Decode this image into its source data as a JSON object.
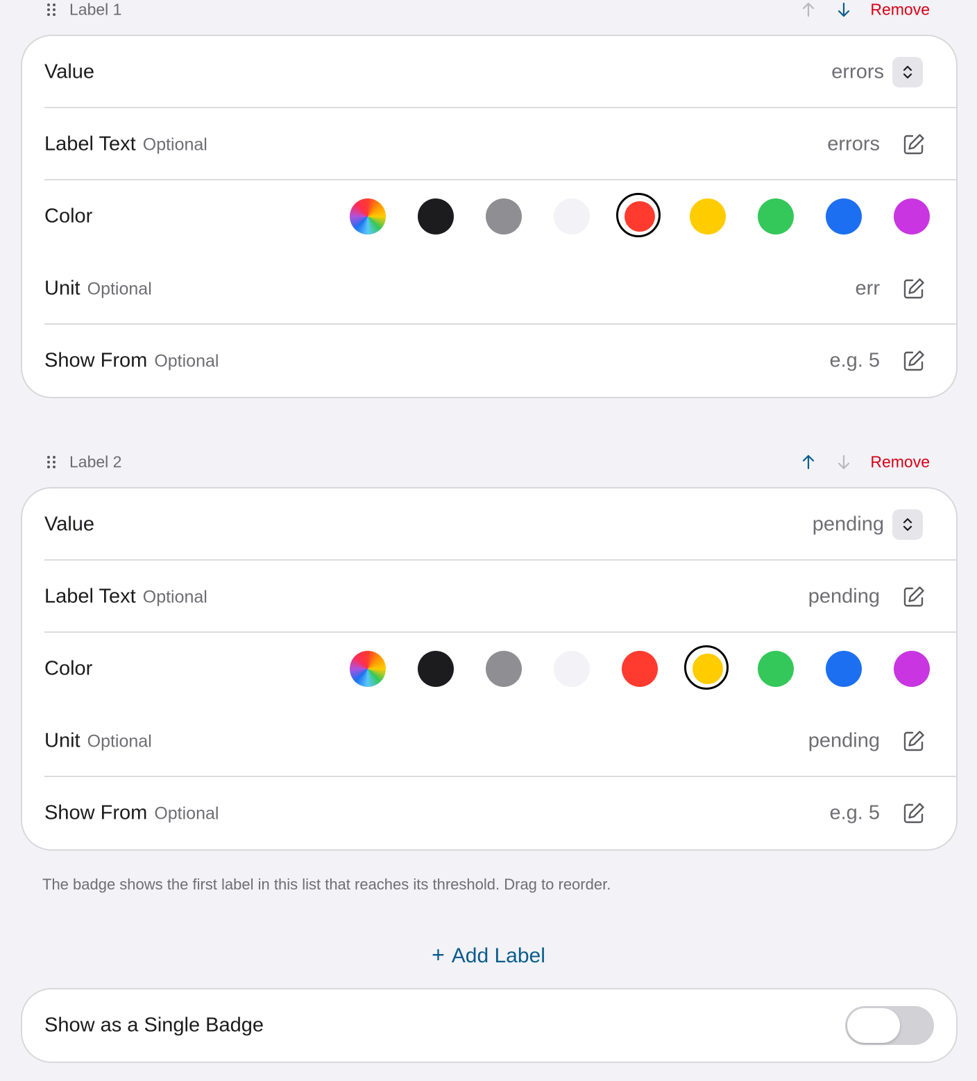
{
  "labels": [
    {
      "title": "Label 1",
      "remove_label": "Remove",
      "value_label": "Value",
      "value": "errors",
      "label_text_label": "Label Text",
      "label_text_optional": "Optional",
      "label_text_value": "errors",
      "color_label": "Color",
      "selected_color": "red",
      "unit_label": "Unit",
      "unit_optional": "Optional",
      "unit_value": "err",
      "show_from_label": "Show From",
      "show_from_optional": "Optional",
      "show_from_placeholder": "e.g. 5"
    },
    {
      "title": "Label 2",
      "remove_label": "Remove",
      "value_label": "Value",
      "value": "pending",
      "label_text_label": "Label Text",
      "label_text_optional": "Optional",
      "label_text_value": "pending",
      "color_label": "Color",
      "selected_color": "yellow",
      "unit_label": "Unit",
      "unit_optional": "Optional",
      "unit_value": "pending",
      "show_from_label": "Show From",
      "show_from_optional": "Optional",
      "show_from_placeholder": "e.g. 5"
    }
  ],
  "colors": [
    {
      "name": "multicolor",
      "hex": "conic"
    },
    {
      "name": "black",
      "hex": "#1c1c1e"
    },
    {
      "name": "gray",
      "hex": "#8e8e93"
    },
    {
      "name": "light",
      "hex": "#f2f2f7"
    },
    {
      "name": "red",
      "hex": "#ff3b30"
    },
    {
      "name": "yellow",
      "hex": "#ffcc00"
    },
    {
      "name": "green",
      "hex": "#34c759"
    },
    {
      "name": "blue",
      "hex": "#1c6ff0"
    },
    {
      "name": "purple",
      "hex": "#c935e0"
    }
  ],
  "footnote": "The badge shows the first label in this list that reaches its threshold. Drag to reorder.",
  "add_label": {
    "plus": "+",
    "text": "Add Label"
  },
  "single_badge": {
    "label": "Show as a Single Badge",
    "enabled": false
  },
  "accent": "#0a5d8c",
  "destructive": "#d70015"
}
